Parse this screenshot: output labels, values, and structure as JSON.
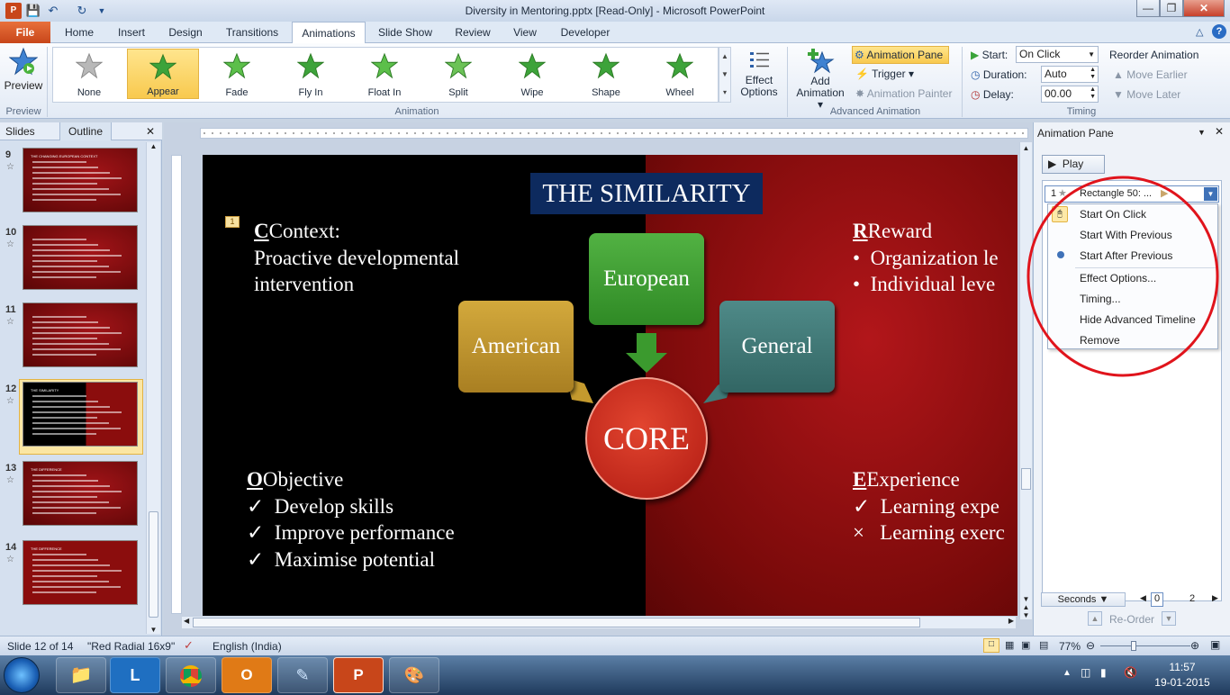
{
  "window": {
    "title": "Diversity in Mentoring.pptx [Read-Only] - Microsoft PowerPoint"
  },
  "tabs": [
    "File",
    "Home",
    "Insert",
    "Design",
    "Transitions",
    "Animations",
    "Slide Show",
    "Review",
    "View",
    "Developer"
  ],
  "ribbon": {
    "preview_label": "Preview",
    "preview_group": "Preview",
    "animations_group": "Animation",
    "animations": [
      {
        "label": "None",
        "icon": "none-star-icon"
      },
      {
        "label": "Appear",
        "icon": "appear-star-icon",
        "selected": true
      },
      {
        "label": "Fade",
        "icon": "fade-star-icon"
      },
      {
        "label": "Fly In",
        "icon": "fly-in-star-icon"
      },
      {
        "label": "Float In",
        "icon": "float-in-star-icon"
      },
      {
        "label": "Split",
        "icon": "split-star-icon"
      },
      {
        "label": "Wipe",
        "icon": "wipe-star-icon"
      },
      {
        "label": "Shape",
        "icon": "shape-star-icon"
      },
      {
        "label": "Wheel",
        "icon": "wheel-star-icon"
      }
    ],
    "effect_options_1": "Effect",
    "effect_options_2": "Options",
    "add_animation_1": "Add",
    "add_animation_2": "Animation",
    "animation_pane_btn": "Animation Pane",
    "trigger_btn": "Trigger",
    "animation_painter_btn": "Animation Painter",
    "advanced_group": "Advanced Animation",
    "start_label": "Start:",
    "start_value": "On Click",
    "duration_label": "Duration:",
    "duration_value": "Auto",
    "delay_label": "Delay:",
    "delay_value": "00.00",
    "reorder_title": "Reorder Animation",
    "move_earlier": "Move Earlier",
    "move_later": "Move Later",
    "timing_group": "Timing"
  },
  "left_panel": {
    "tab_slides": "Slides",
    "tab_outline": "Outline",
    "slides": [
      {
        "num": "9",
        "title": "THE CHANGING EUROPEAN CONTEXT"
      },
      {
        "num": "10",
        "title": ""
      },
      {
        "num": "11",
        "title": ""
      },
      {
        "num": "12",
        "title": "THE SIMILARITY",
        "selected": true
      },
      {
        "num": "13",
        "title": "THE DIFFERENCE"
      },
      {
        "num": "14",
        "title": "THE DIFFERENCE"
      }
    ]
  },
  "slide": {
    "title": "THE SIMILARITY",
    "anim_tag": "1",
    "context_head": "Context:",
    "context_line1": "Proactive developmental",
    "context_line2": "intervention",
    "reward_head": "Reward",
    "reward_items": [
      "Organization le",
      "Individual leve"
    ],
    "objective_head": "Objective",
    "objective_items": [
      "Develop skills",
      "Improve performance",
      "Maximise potential"
    ],
    "experience_head": "Experience",
    "experience_items": [
      "Learning expe",
      "Learning exerc"
    ],
    "box_european": "European",
    "box_american": "American",
    "box_general": "General",
    "core": "CORE"
  },
  "anim_pane": {
    "title": "Animation Pane",
    "play": "Play",
    "item_num": "1",
    "item_label": "Rectangle 50: ...",
    "menu": [
      "Start On Click",
      "Start With Previous",
      "Start After Previous",
      "Effect Options...",
      "Timing...",
      "Hide Advanced Timeline",
      "Remove"
    ],
    "seconds_label": "Seconds",
    "timeline_0": "0",
    "timeline_2": "2",
    "reorder": "Re-Order"
  },
  "status": {
    "slide_info": "Slide 12 of 14",
    "theme": "\"Red Radial 16x9\"",
    "language": "English (India)",
    "zoom": "77%"
  },
  "taskbar": {
    "time": "11:57",
    "date": "19-01-2015"
  },
  "colors": {
    "slide_red": "#8b0d0d",
    "box_green": "#3a8f2e",
    "box_gold": "#b8902e",
    "box_teal": "#3f7a78",
    "core_red": "#c9271f",
    "title_navy": "#0d2a5e",
    "annotation_circle": "#e0141c"
  }
}
